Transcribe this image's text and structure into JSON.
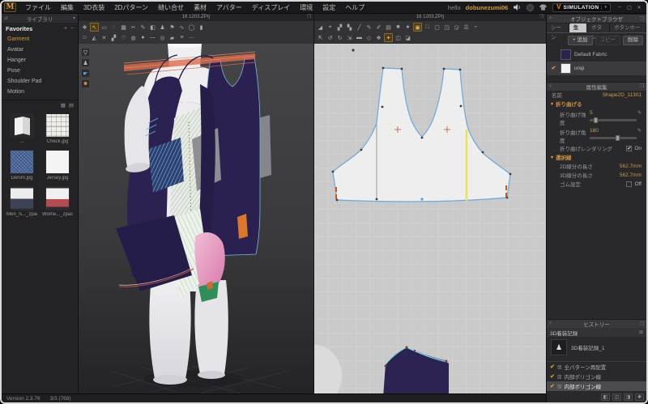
{
  "titlebar": {
    "logo": "M",
    "menus": [
      {
        "label": "ファイル"
      },
      {
        "label": "編集"
      },
      {
        "label": "3D衣装"
      },
      {
        "label": "2Dパターン"
      },
      {
        "label": "縫い合せ"
      },
      {
        "label": "素材"
      },
      {
        "label": "アバター"
      },
      {
        "label": "ディスプレイ"
      },
      {
        "label": "環境"
      },
      {
        "label": "設定"
      },
      {
        "label": "ヘルプ"
      }
    ],
    "greeting": "hello",
    "username": "dobunezumi06",
    "simulation": "SIMULATION",
    "window_controls": [
      {
        "n": "minimize-button",
        "g": "─"
      },
      {
        "n": "maximize-button",
        "g": "▢"
      },
      {
        "n": "close-button",
        "g": "✕"
      }
    ]
  },
  "icons": {
    "plus": "+",
    "minus": "−",
    "popout": "❐",
    "collapse": "▾",
    "swap": "⇄",
    "pencil": "✎",
    "check": "✔",
    "grid_view": "▦",
    "list_view": "▤",
    "camera": "⊞",
    "speaker_note": "▸)))",
    "sim_logo": "V",
    "caret": "▼"
  },
  "library": {
    "header": "ライブラリ",
    "favorites": "Favorites",
    "items": [
      {
        "label": "Garment",
        "s": "active"
      },
      {
        "label": "Avatar"
      },
      {
        "label": "Hanger"
      },
      {
        "label": "Pose"
      },
      {
        "label": "Shoulder Pad"
      },
      {
        "label": "Motion"
      }
    ],
    "assets": [
      {
        "label": "...",
        "kind": "folder"
      },
      {
        "label": "Check.jpg",
        "kind": "check"
      },
      {
        "label": "Denim.jpg",
        "kind": "denim"
      },
      {
        "label": "Jersey.jpg",
        "kind": "jersey"
      },
      {
        "label": "Men_S..._zpac",
        "kind": "men"
      },
      {
        "label": "Wome..._zpac",
        "kind": "women"
      }
    ]
  },
  "viewport3d": {
    "title": "16 1203.ZPrj",
    "tools_row1": [
      {
        "n": "simulate-tool",
        "g": "❖"
      },
      {
        "n": "select-move-tool",
        "g": "↖",
        "s": "active"
      },
      {
        "n": "select-box-tool",
        "g": "▭"
      },
      {
        "n": "select-lasso-tool",
        "g": "◌"
      },
      {
        "n": "select-mesh-tool",
        "g": "▦"
      },
      {
        "n": "pin-tool",
        "g": "✂"
      },
      {
        "n": "sewing-tool",
        "g": "✎"
      },
      {
        "n": "steam-iron-tool",
        "g": "◧"
      },
      {
        "n": "avatar-display-tool",
        "g": "♟"
      },
      {
        "n": "pin-box-tool",
        "g": "⚑"
      },
      {
        "n": "tape-measure-tool",
        "g": "∿"
      },
      {
        "n": "circumference-tool",
        "g": "◯"
      },
      {
        "n": "ruler-tool",
        "g": "▮"
      }
    ],
    "tools_row2": [
      {
        "n": "walk-pose-tool",
        "g": "☺"
      },
      {
        "n": "arrange-tool",
        "g": "◭"
      },
      {
        "n": "gizmo-world-tool",
        "g": "✕"
      },
      {
        "n": "fabric-direction-tool",
        "g": "▞"
      },
      {
        "n": "bind-tool",
        "g": "♡"
      },
      {
        "n": "button-tool",
        "g": "◍"
      },
      {
        "n": "buttonhole-tool",
        "g": "●"
      },
      {
        "n": "zipper-tool",
        "g": "—"
      },
      {
        "n": "topstitch-3d-tool",
        "g": "◎"
      },
      {
        "n": "puckering-tool",
        "g": "▰"
      },
      {
        "n": "measure-list-tool",
        "g": "≡"
      },
      {
        "n": "more-tools",
        "g": "⋯"
      }
    ],
    "display_toggles": [
      {
        "n": "show-garment-toggle",
        "g": "▽",
        "c": "#e8e8e8"
      },
      {
        "n": "show-avatar-toggle",
        "g": "♟",
        "c": "#b8b8b8"
      },
      {
        "n": "show-arrangement-toggle",
        "g": "☛",
        "c": "#5aa0d8"
      },
      {
        "n": "show-avatar-parts-toggle",
        "g": "☻",
        "c": "#d8904a"
      }
    ]
  },
  "viewport2d": {
    "title": "16 1203.ZPrj",
    "tools_row1": [
      {
        "n": "transform-pattern-tool",
        "g": "◢"
      },
      {
        "n": "edit-pattern-tool",
        "g": "⌖"
      },
      {
        "n": "edit-point-tool",
        "g": "▞"
      },
      {
        "n": "edit-curvature-tool",
        "g": "▚"
      },
      {
        "n": "edit-curve-point-tool",
        "g": "╱"
      },
      {
        "n": "add-point-tool",
        "g": "✎"
      },
      {
        "n": "polygon-tool",
        "g": "✐"
      },
      {
        "n": "rectangle-pattern-tool",
        "g": "▤"
      },
      {
        "n": "filled-rectangle-tool",
        "g": "■"
      },
      {
        "n": "circle-pattern-tool",
        "g": "●"
      },
      {
        "n": "internal-polygon-tool",
        "g": "▣",
        "s": "active"
      },
      {
        "n": "internal-rectangle-tool",
        "g": "□"
      },
      {
        "n": "internal-circle-tool",
        "g": "▢"
      },
      {
        "n": "dart-tool",
        "g": "◳"
      },
      {
        "n": "base-line-tool",
        "g": "◶"
      },
      {
        "n": "trace-tool",
        "g": "☰"
      },
      {
        "n": "seam-allowance-tool",
        "g": "⌐"
      }
    ],
    "tools_row2": [
      {
        "n": "sew-segment-tool",
        "g": "⇱"
      },
      {
        "n": "sew-free-tool",
        "g": "↺"
      },
      {
        "n": "sew-mn-segment-tool",
        "g": "↻"
      },
      {
        "n": "sew-mn-free-tool",
        "g": "⇲"
      },
      {
        "n": "fold-arrange-tool",
        "g": "▬"
      },
      {
        "n": "attach-button-tool",
        "g": "◇"
      },
      {
        "n": "elastic-tool",
        "g": "❖"
      },
      {
        "n": "internal-line-tool",
        "g": "✦",
        "s": "active"
      },
      {
        "n": "add-pattern-tool",
        "g": "◫"
      },
      {
        "n": "remove-pattern-tool",
        "g": "◪"
      }
    ]
  },
  "object_browser": {
    "title": "オブジェクトブラウザ",
    "tabs": [
      {
        "label": "シーン"
      },
      {
        "label": "生地",
        "s": "active"
      },
      {
        "label": "ボタン"
      },
      {
        "label": "ボタンホール"
      }
    ],
    "add": "+ 追加",
    "copy": "コピー",
    "del": "削除",
    "fabrics": [
      {
        "name": "Default Fabric",
        "swatch": "#2a2250",
        "check": ""
      },
      {
        "name": "uraji",
        "swatch": "#f2f2f3",
        "check": "✔",
        "s": "selected"
      }
    ]
  },
  "property_editor": {
    "title": "属性編集",
    "name_label": "名前",
    "name_value": "Shape2D_11301",
    "fold_section": "折り曲げる",
    "fold_strength_label": "折り曲げ強度",
    "fold_strength_value": "5",
    "fold_angle_label": "折り曲げ角度",
    "fold_angle_value": "180",
    "fold_render_label": "折り曲げレンダリング",
    "fold_render_value": "On",
    "selection_section": "選択線",
    "len2d_label": "2D線分の長さ",
    "len2d_value": "562.7mm",
    "len3d_label": "3D線分の長さ",
    "len3d_value": "562.7mm",
    "elastic_label": "ゴム設定",
    "elastic_value": "Off"
  },
  "history": {
    "title": "ヒストリー",
    "record_header": "3D着装記録",
    "record_icon": "♟",
    "record_label": "3D着装記録_1",
    "steps": [
      {
        "icon": "▥",
        "label": "全パターン再配置"
      },
      {
        "icon": "▥",
        "label": "内部ポリゴン線"
      },
      {
        "icon": "▥",
        "label": "内部ポリゴン線",
        "s": "selected"
      }
    ],
    "footer": [
      {
        "n": "layout-one-icon",
        "g": "◧"
      },
      {
        "n": "layout-two-icon",
        "g": "◫"
      },
      {
        "n": "layout-three-icon",
        "g": "◨"
      },
      {
        "n": "settings-icon",
        "g": "✱"
      }
    ]
  },
  "statusbar": {
    "version": "Version 2.3.76",
    "counter": "3/3 (768)"
  }
}
